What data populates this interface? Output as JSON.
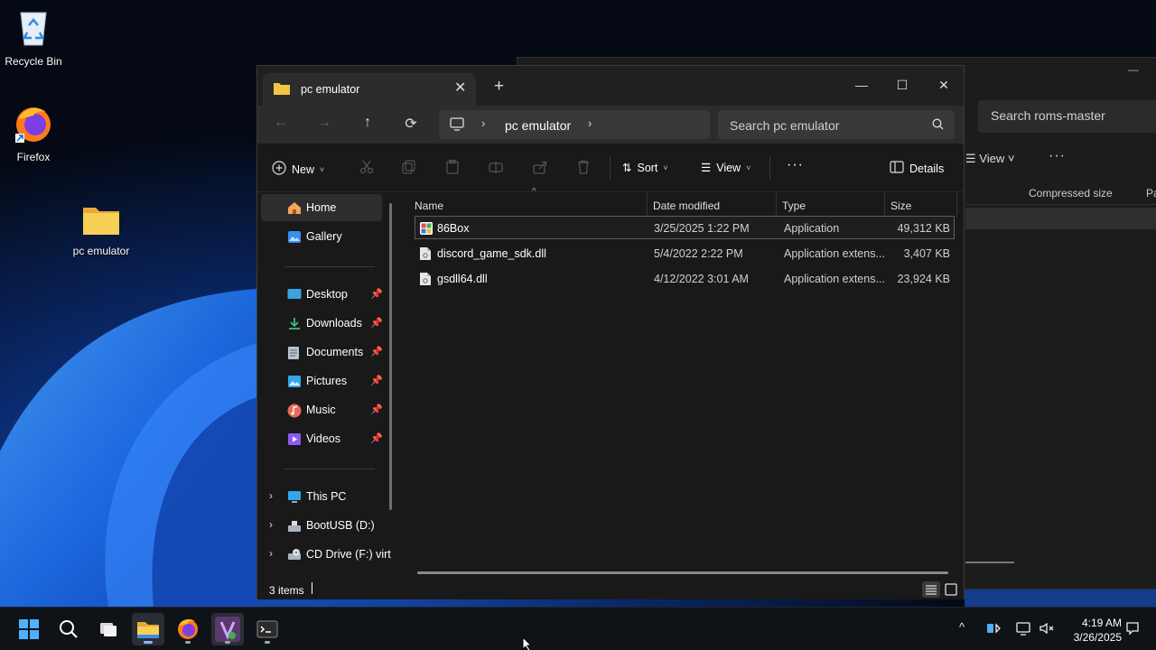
{
  "desktop": {
    "icons": [
      {
        "label": "Recycle Bin",
        "icon": "recycle-bin-icon"
      },
      {
        "label": "Firefox",
        "icon": "firefox-icon"
      },
      {
        "label": "pc emulator",
        "icon": "folder-icon"
      }
    ]
  },
  "background_window": {
    "search_placeholder": "Search roms-master",
    "view_label": "View",
    "columns": [
      "Compressed size",
      "Pa"
    ]
  },
  "explorer": {
    "tab_title": "pc emulator",
    "window_controls": {
      "minimize": "—",
      "maximize": "☐",
      "close": "✕"
    },
    "breadcrumb": "pc emulator",
    "search_placeholder": "Search pc emulator",
    "commands": {
      "new": "New",
      "sort": "Sort",
      "view": "View",
      "more": "···",
      "details": "Details"
    },
    "nav": {
      "home": "Home",
      "gallery": "Gallery",
      "desktop": "Desktop",
      "downloads": "Downloads",
      "documents": "Documents",
      "pictures": "Pictures",
      "music": "Music",
      "videos": "Videos",
      "this_pc": "This PC",
      "bootusb": "BootUSB (D:)",
      "cd_drive": "CD Drive (F:) virt"
    },
    "columns": {
      "name": "Name",
      "date": "Date modified",
      "type": "Type",
      "size": "Size"
    },
    "files": [
      {
        "name": "86Box",
        "date": "3/25/2025 1:22 PM",
        "type": "Application",
        "size": "49,312 KB",
        "icon": "app-icon"
      },
      {
        "name": "discord_game_sdk.dll",
        "date": "5/4/2022 2:22 PM",
        "type": "Application extens...",
        "size": "3,407 KB",
        "icon": "dll-file-icon"
      },
      {
        "name": "gsdll64.dll",
        "date": "4/12/2022 3:01 AM",
        "type": "Application extens...",
        "size": "23,924 KB",
        "icon": "dll-file-icon"
      }
    ],
    "status": {
      "item_count": "3 items"
    }
  },
  "taskbar": {
    "clock_time": "4:19 AM",
    "clock_date": "3/26/2025",
    "apps": [
      "start-icon",
      "search-icon",
      "task-view-icon",
      "file-explorer-icon",
      "firefox-icon",
      "visual-studio-icon",
      "terminal-icon"
    ]
  },
  "colors": {
    "accent": "#8fb3ff",
    "window_bg": "#191919",
    "titlebar": "#202020",
    "folder": "#f4c542"
  }
}
